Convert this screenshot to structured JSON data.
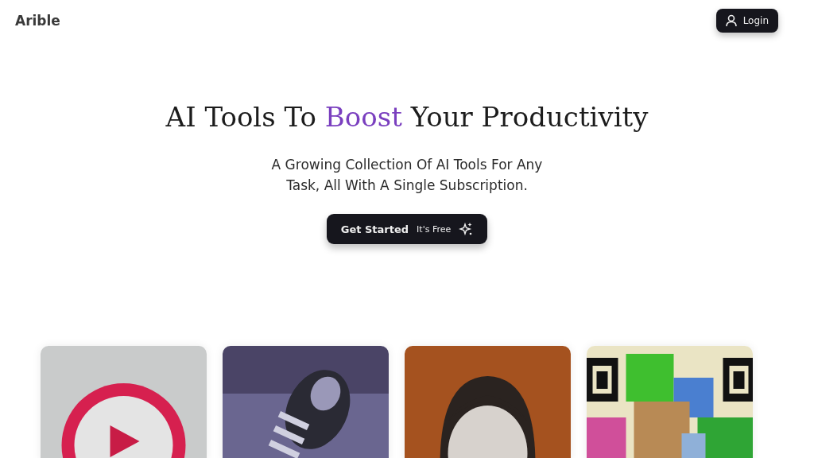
{
  "header": {
    "logo": "Arible",
    "login_button": "Login"
  },
  "hero": {
    "title_before": "AI Tools To ",
    "title_highlight": "Boost",
    "title_after": " Your Productivity",
    "subtitle": "A Growing Collection Of AI Tools For Any Task, All With A Single Subscription.",
    "cta": {
      "label": "Get Started",
      "note": "It's Free"
    }
  }
}
